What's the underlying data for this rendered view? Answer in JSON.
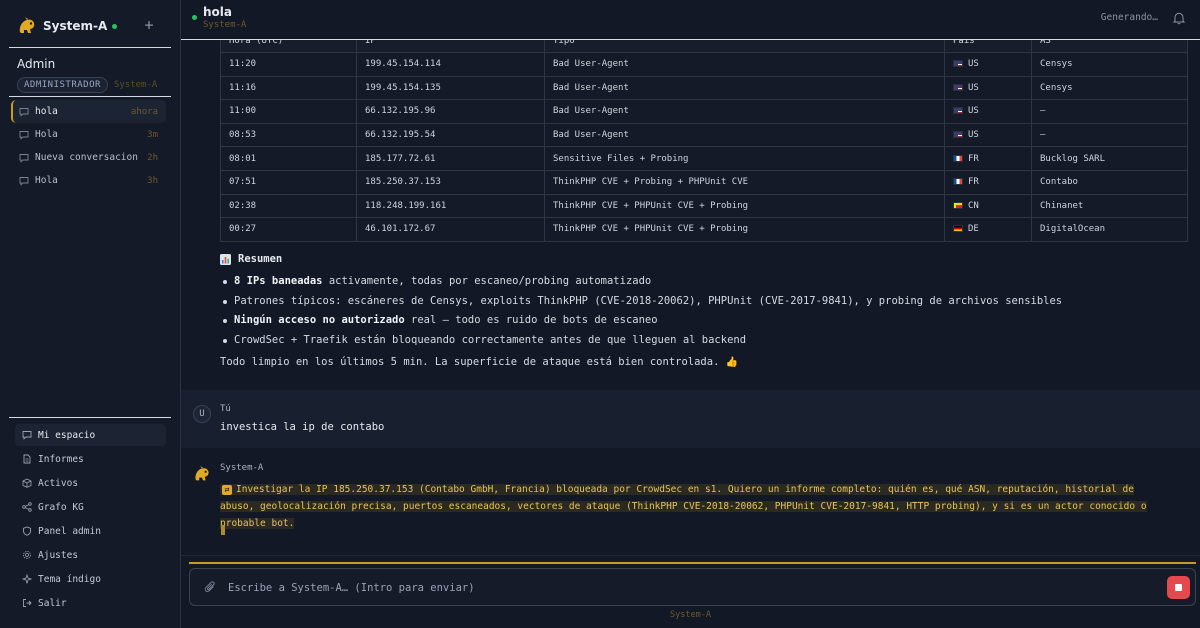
{
  "sidebar": {
    "brand": "System-A",
    "new_chat_icon": "plus-icon",
    "user": {
      "name": "Admin",
      "role": "ADMINISTRADOR",
      "brand": "System-A"
    },
    "conversations": [
      {
        "label": "hola",
        "time": "ahora",
        "active": true
      },
      {
        "label": "Hola",
        "time": "3m"
      },
      {
        "label": "Nueva conversacion",
        "time": "2h"
      },
      {
        "label": "Hola",
        "time": "3h"
      }
    ],
    "nav": [
      {
        "label": "Mi espacio",
        "icon": "chat-icon",
        "active": true
      },
      {
        "label": "Informes",
        "icon": "document-icon"
      },
      {
        "label": "Activos",
        "icon": "box-icon"
      },
      {
        "label": "Grafo KG",
        "icon": "graph-icon"
      },
      {
        "label": "Panel admin",
        "icon": "shield-icon"
      },
      {
        "label": "Ajustes",
        "icon": "gear-icon"
      },
      {
        "label": "Tema índigo",
        "icon": "theme-icon"
      },
      {
        "label": "Salir",
        "icon": "logout-icon"
      }
    ]
  },
  "header": {
    "title": "hola",
    "subtitle": "System-A",
    "status": "Generando…"
  },
  "table": {
    "headers": [
      "Hora (UTC)",
      "IP",
      "Tipo",
      "País",
      "AS"
    ],
    "rows": [
      [
        "11:20",
        "199.45.154.114",
        "Bad User-Agent",
        "US",
        "Censys"
      ],
      [
        "11:16",
        "199.45.154.135",
        "Bad User-Agent",
        "US",
        "Censys"
      ],
      [
        "11:00",
        "66.132.195.96",
        "Bad User-Agent",
        "US",
        "—"
      ],
      [
        "08:53",
        "66.132.195.54",
        "Bad User-Agent",
        "US",
        "—"
      ],
      [
        "08:01",
        "185.177.72.61",
        "Sensitive Files + Probing",
        "FR",
        "Bucklog SARL"
      ],
      [
        "07:51",
        "185.250.37.153",
        "ThinkPHP CVE + Probing + PHPUnit CVE",
        "FR",
        "Contabo"
      ],
      [
        "02:38",
        "118.248.199.161",
        "ThinkPHP CVE + PHPUnit CVE + Probing",
        "CN",
        "Chinanet"
      ],
      [
        "00:27",
        "46.101.172.67",
        "ThinkPHP CVE + PHPUnit CVE + Probing",
        "DE",
        "DigitalOcean"
      ]
    ]
  },
  "summary": {
    "title": "Resumen",
    "items": [
      {
        "bold": "8 IPs baneadas",
        "text": " activamente, todas por escaneo/probing automatizado"
      },
      {
        "bold": "",
        "text": "Patrones típicos: escáneres de Censys, exploits ThinkPHP (CVE-2018-20062), PHPUnit (CVE-2017-9841), y probing de archivos sensibles"
      },
      {
        "bold": "Ningún acceso no autorizado",
        "text": " real — todo es ruido de bots de escaneo"
      },
      {
        "bold": "",
        "text": "CrowdSec + Traefik están bloqueando correctamente antes de que lleguen al backend"
      }
    ],
    "final": "Todo limpio en los últimos 5 min. La superficie de ataque está bien controlada."
  },
  "user_message": {
    "avatar": "U",
    "author": "Tú",
    "text": "investica la ip de contabo"
  },
  "bot_message": {
    "author": "System-A",
    "text": "Investigar la IP 185.250.37.153 (Contabo GmbH, Francia) bloqueada por CrowdSec en s1. Quiero un informe completo: quién es, qué ASN, reputación, historial de abuso, geolocalización precisa, puertos escaneados, vectores de ataque (ThinkPHP CVE-2018-20062, PHPUnit CVE-2017-9841, HTTP probing), y si es un actor conocido o probable bot."
  },
  "composer": {
    "placeholder": "Escribe a System-A… (Intro para enviar)",
    "footer": "System-A",
    "progress": 1.0
  },
  "colors": {
    "accent": "#c79a2e",
    "online": "#22c55e",
    "stop": "#e5484d",
    "stream_text": "#e8c25a"
  }
}
